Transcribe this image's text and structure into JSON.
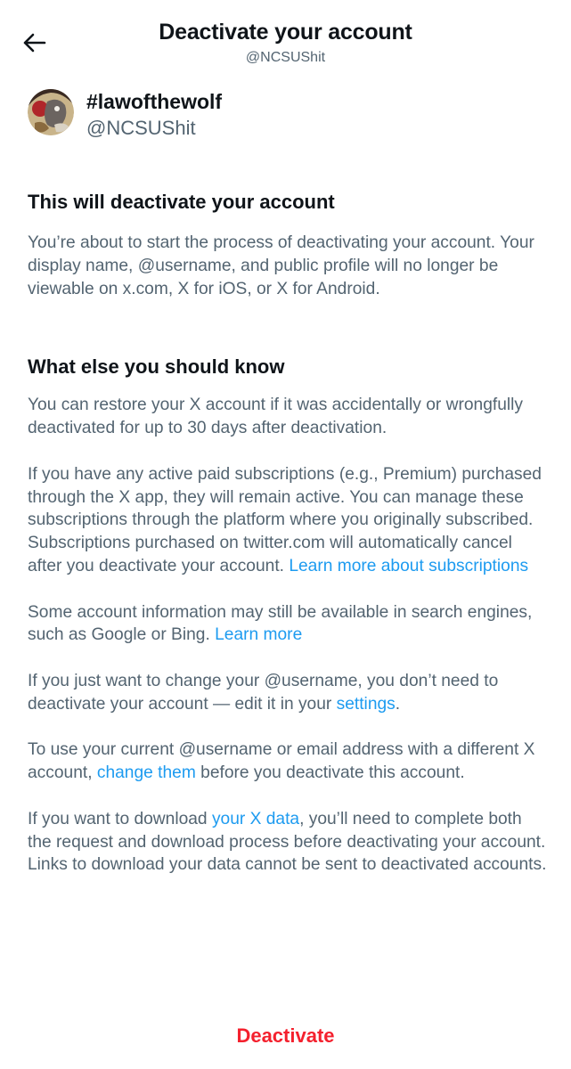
{
  "header": {
    "title": "Deactivate your account",
    "subtitle": "@NCSUShit",
    "back_icon": "arrow-left-icon"
  },
  "profile": {
    "display_name": "#lawofthewolf",
    "handle": "@NCSUShit"
  },
  "section1": {
    "title": "This will deactivate your account",
    "body": "You’re about to start the process of deactivating your account. Your display name, @username, and public profile will no longer be viewable on x.com, X for iOS, or X for Android."
  },
  "section2": {
    "title": "What else you should know",
    "p1": "You can restore your X account if it was accidentally or wrongfully deactivated for up to 30 days after deactivation.",
    "p2_text": "If you have any active paid subscriptions (e.g., Premium) purchased through the X app, they will remain active. You can manage these subscriptions through the platform where you originally subscribed. Subscriptions purchased on twitter.com will automatically cancel after you deactivate your account. ",
    "p2_link": "Learn more about subscriptions",
    "p3_text": "Some account information may still be available in search engines, such as Google or Bing. ",
    "p3_link": "Learn more",
    "p4_text": "If you just want to change your @username, you don’t need to deactivate your account — edit it in your ",
    "p4_link": "settings",
    "p4_end": ".",
    "p5_text": "To use your current @username or email address with a different X account, ",
    "p5_link": "change them",
    "p5_end": " before you deactivate this account.",
    "p6_text": "If you want to download ",
    "p6_link": "your X data",
    "p6_end": ", you’ll need to complete both the request and download process before deactivating your account. Links to download your data cannot be sent to deactivated accounts."
  },
  "actions": {
    "deactivate_label": "Deactivate"
  },
  "colors": {
    "link": "#1d9bf0",
    "danger": "#f4212e",
    "secondary_text": "#536471",
    "primary_text": "#0f1419"
  }
}
